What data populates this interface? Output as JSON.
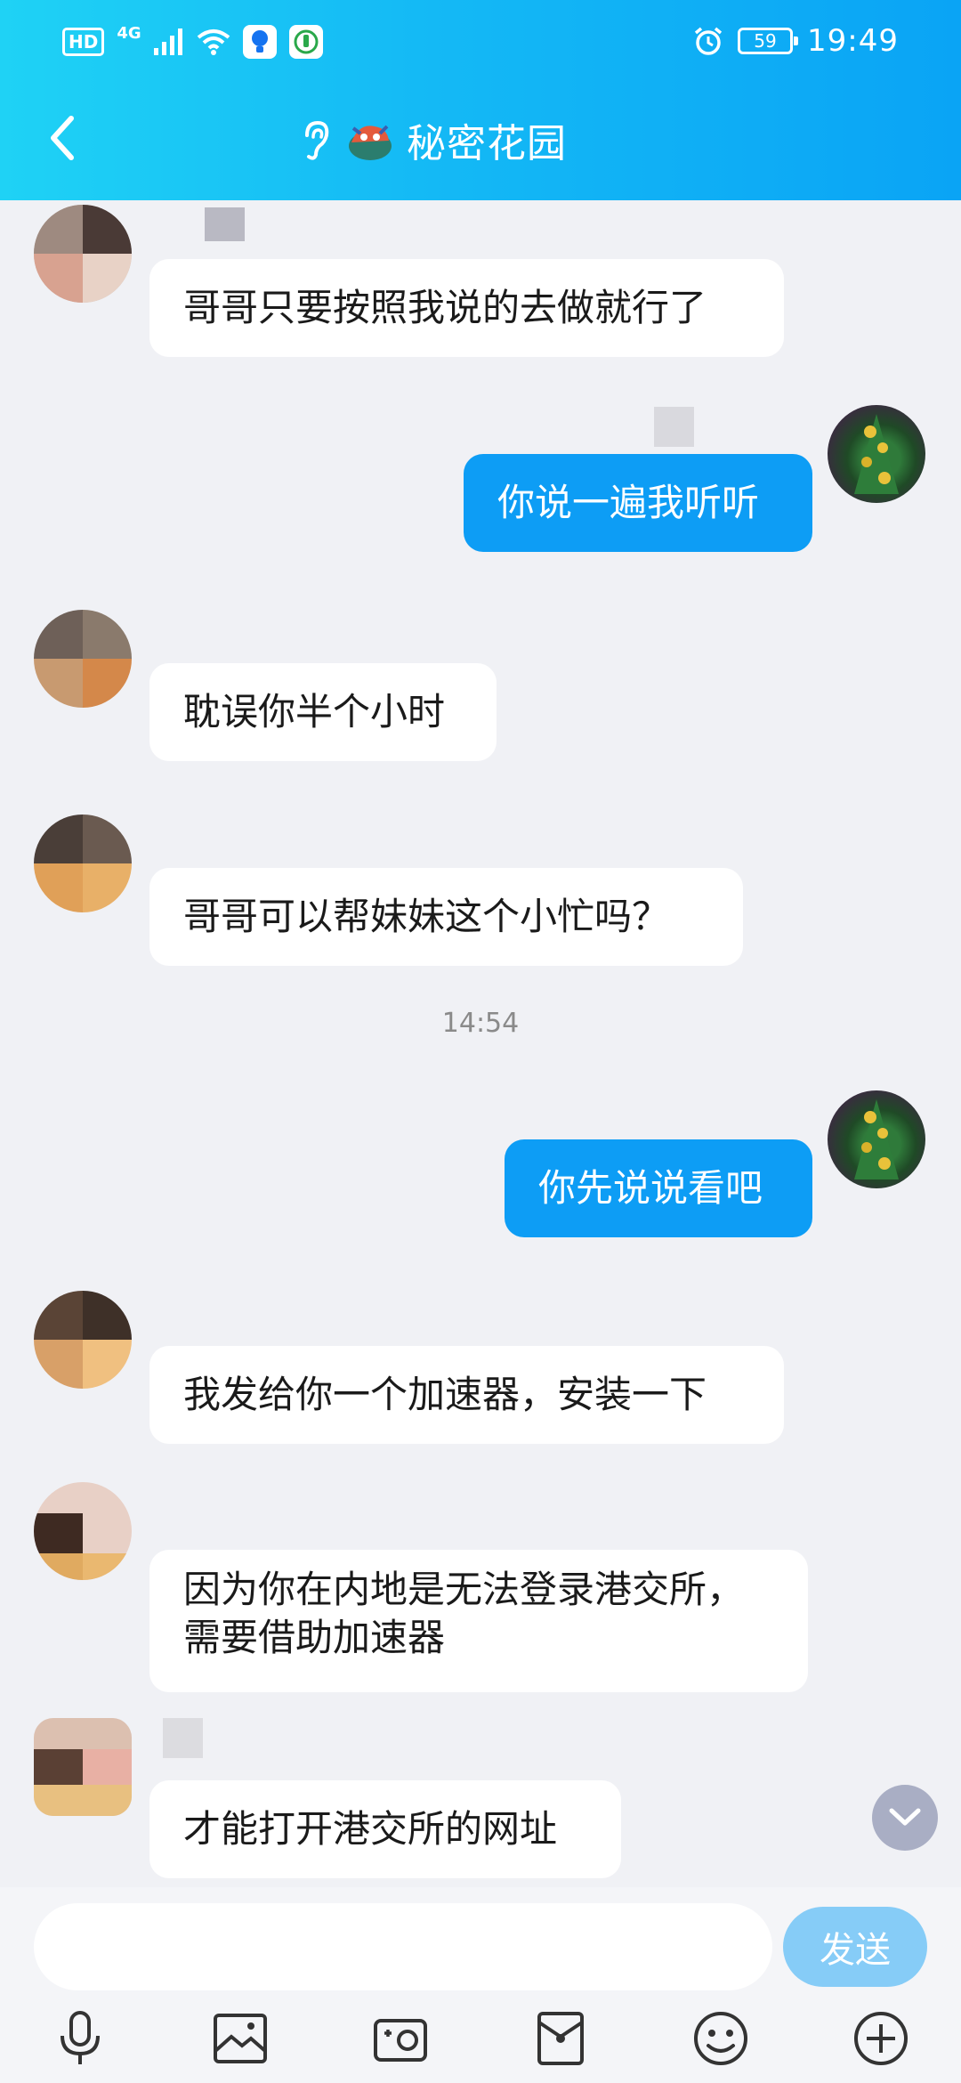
{
  "status_bar": {
    "hd": "HD",
    "network": "4G",
    "battery": "59",
    "time": "19:49"
  },
  "nav": {
    "title": "秘密花园"
  },
  "messages": [
    {
      "side": "in",
      "text": "哥哥只要按照我说的去做就行了"
    },
    {
      "side": "out",
      "text": "你说一遍我听听"
    },
    {
      "side": "in",
      "text": "耽误你半个小时"
    },
    {
      "side": "in",
      "text": "哥哥可以帮妹妹这个小忙吗？"
    },
    {
      "side": "out",
      "text": "你先说说看吧"
    },
    {
      "side": "in",
      "text": "我发给你一个加速器，安装一下"
    },
    {
      "side": "in",
      "text": "因为你在内地是无法登录港交所，需要借助加速器"
    },
    {
      "side": "in",
      "text": "才能打开港交所的网址"
    }
  ],
  "time_separator": "14:54",
  "input": {
    "placeholder": "",
    "send_label": "发送"
  },
  "toolbar_icons": [
    "microphone-icon",
    "image-icon",
    "camera-icon",
    "red-packet-icon",
    "emoji-icon",
    "plus-icon"
  ],
  "colors": {
    "header_start": "#1fd2f5",
    "header_end": "#0aa4f5",
    "outgoing_bubble": "#0d9df5",
    "send_button": "#86ccf7"
  }
}
